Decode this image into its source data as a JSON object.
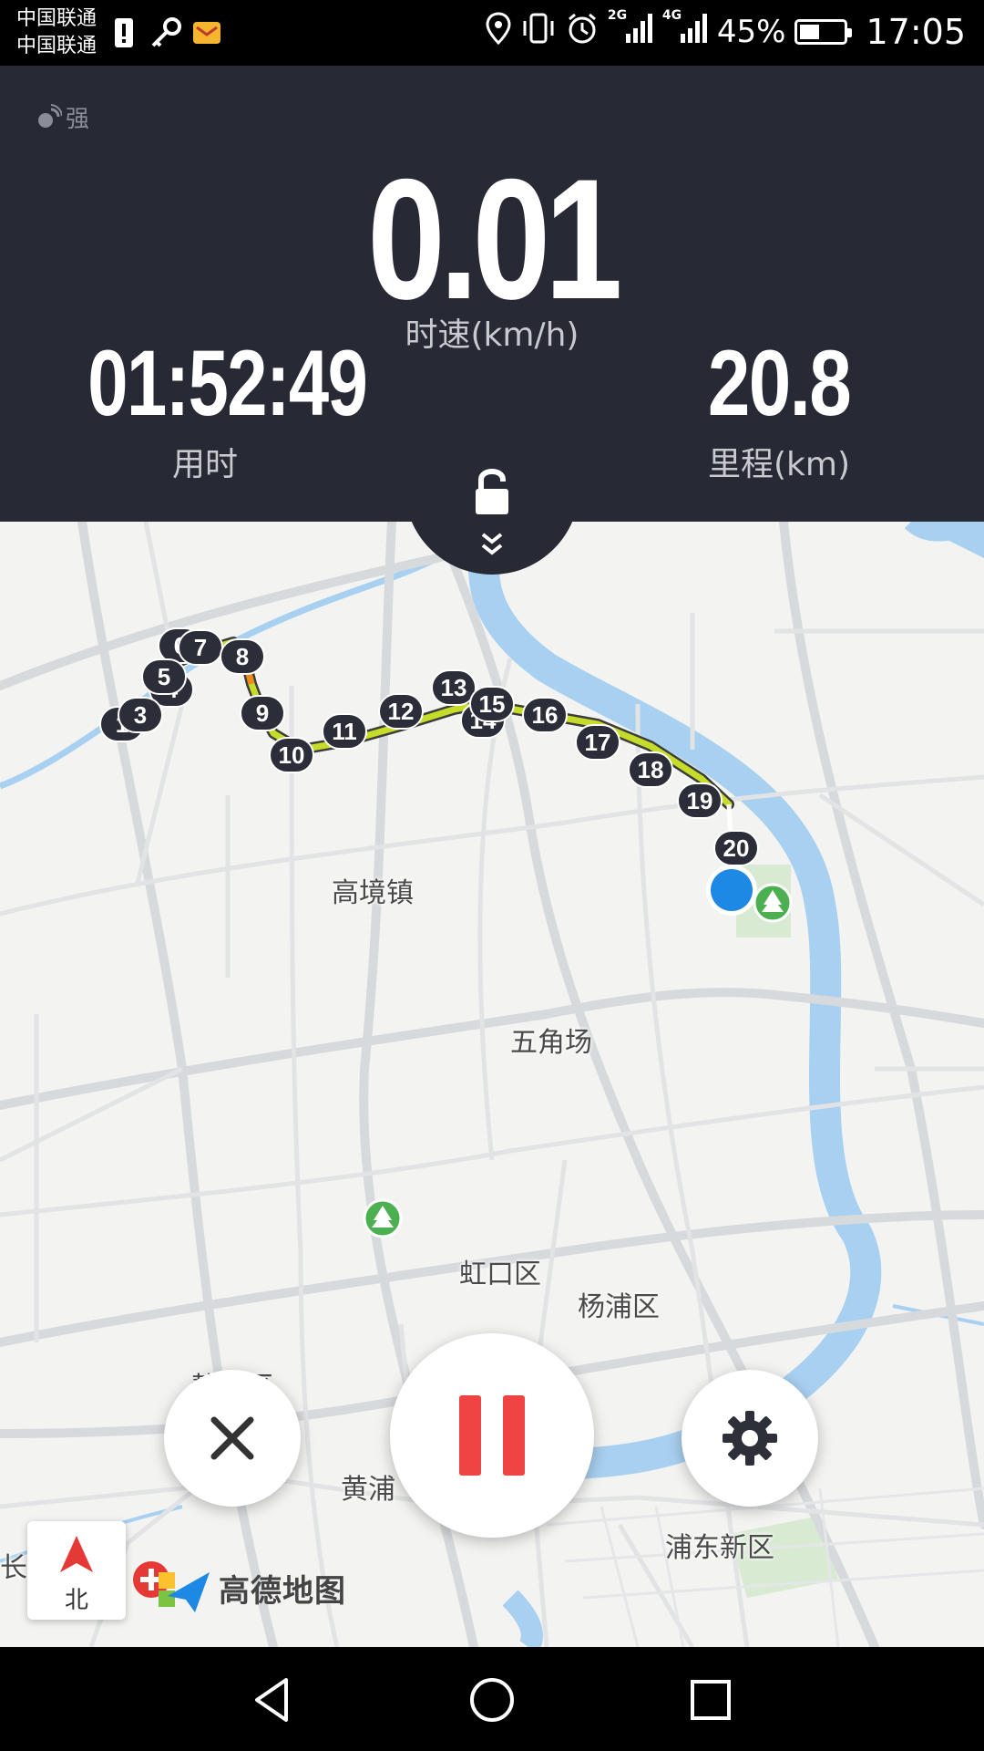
{
  "status_bar": {
    "carrier_1": "中国联通",
    "carrier_2": "中国联通",
    "battery_pct": "45%",
    "battery_level": 0.45,
    "time": "17:05",
    "signal_1_label": "2G",
    "signal_2_label": "4G",
    "icons": [
      "sim-alert-icon",
      "key-icon",
      "mail-icon",
      "location-icon",
      "vibrate-icon",
      "alarm-icon",
      "signal-icon",
      "battery-icon"
    ]
  },
  "stats": {
    "gps_label": "强",
    "speed_value": "0.01",
    "speed_label": "时速(km/h)",
    "time_value": "01:52:49",
    "time_label": "用时",
    "distance_value": "20.8",
    "distance_label": "里程(km)"
  },
  "map": {
    "districts": [
      "高境镇",
      "五角场",
      "虹口区",
      "杨浦区",
      "静安区",
      "黄浦",
      "浦东新区",
      "长"
    ],
    "km_markers": [
      "1",
      "3",
      "4",
      "5",
      "6",
      "7",
      "8",
      "9",
      "10",
      "11",
      "12",
      "13",
      "14",
      "15",
      "16",
      "17",
      "18",
      "19",
      "20"
    ],
    "compass_label": "北",
    "logo_text": "高德地图",
    "colors": {
      "water": "#a8d0f0",
      "road": "#d7dadd",
      "route_marker": "#2b2d38",
      "current_location": "#1e88e5"
    }
  },
  "controls": {
    "close": "close-icon",
    "pause": "pause-icon",
    "settings": "gear-icon",
    "pause_color": "#ee4444"
  },
  "nav_bar": [
    "back-icon",
    "home-icon",
    "recents-icon"
  ]
}
